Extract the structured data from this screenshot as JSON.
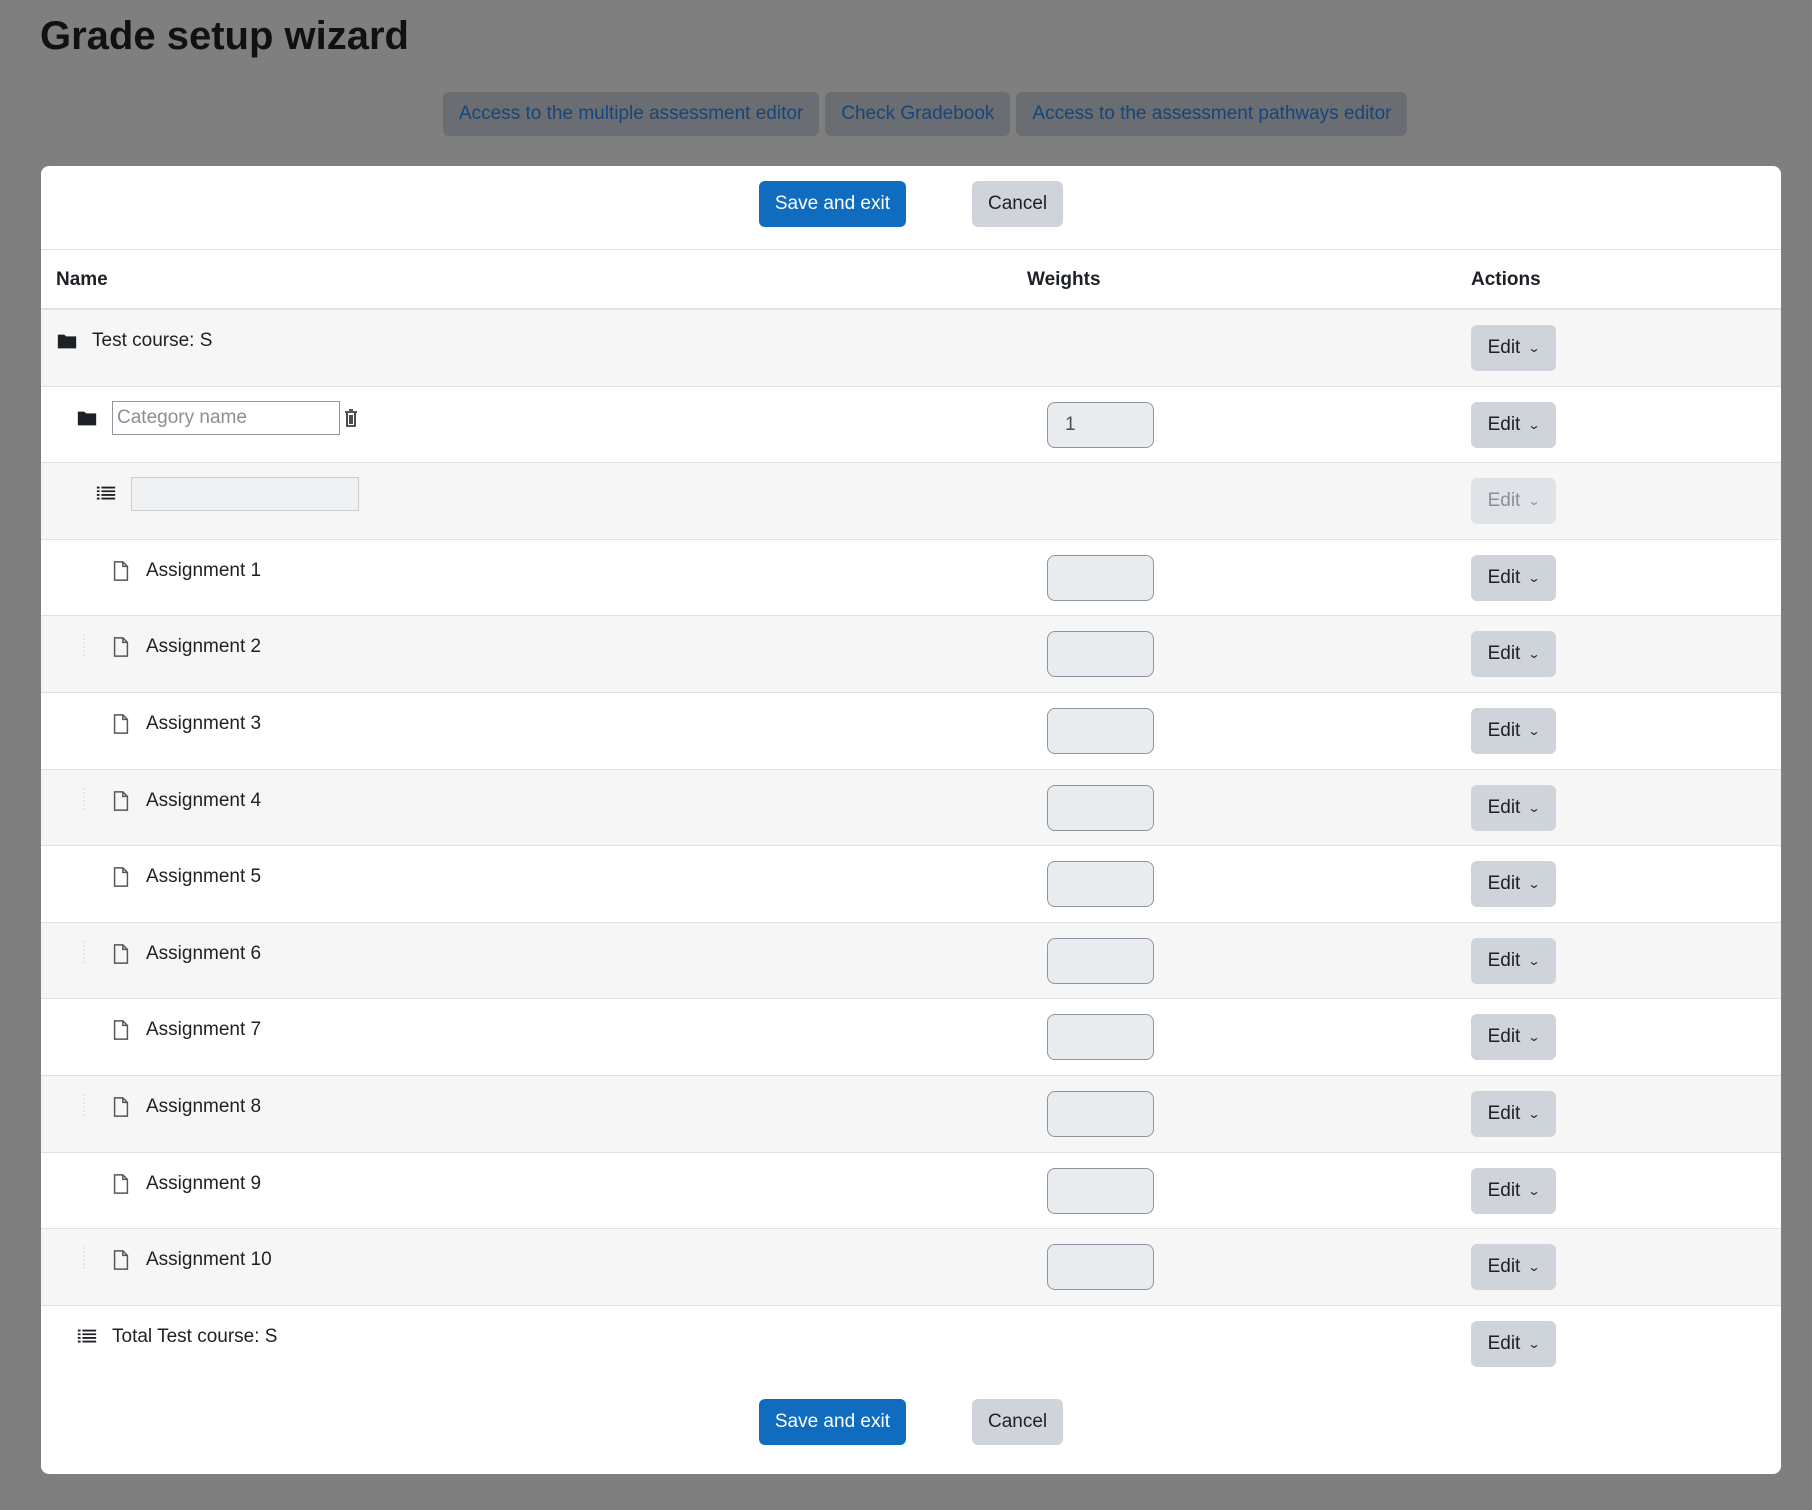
{
  "page": {
    "title": "Grade setup wizard",
    "top_links": [
      {
        "label": "Access to the multiple assessment editor"
      },
      {
        "label": "Check Gradebook"
      },
      {
        "label": "Access to the assessment pathways editor"
      }
    ]
  },
  "buttons": {
    "save": "Save and exit",
    "cancel": "Cancel"
  },
  "table": {
    "headers": {
      "name": "Name",
      "weights": "Weights",
      "actions": "Actions"
    },
    "course": {
      "name": "Test course: S",
      "edit": "Edit",
      "icon": "folder-icon"
    },
    "category": {
      "placeholder": "Category name",
      "value": "",
      "weight": "1",
      "edit": "Edit",
      "icon": "folder-icon",
      "delete_icon": "trash-icon"
    },
    "category_total": {
      "value": "",
      "edit": "Edit",
      "edit_disabled": true,
      "icon": "list-icon"
    },
    "items": [
      {
        "name": "Assignment 1",
        "weight": "",
        "edit": "Edit"
      },
      {
        "name": "Assignment 2",
        "weight": "",
        "edit": "Edit"
      },
      {
        "name": "Assignment 3",
        "weight": "",
        "edit": "Edit"
      },
      {
        "name": "Assignment 4",
        "weight": "",
        "edit": "Edit"
      },
      {
        "name": "Assignment 5",
        "weight": "",
        "edit": "Edit"
      },
      {
        "name": "Assignment 6",
        "weight": "",
        "edit": "Edit"
      },
      {
        "name": "Assignment 7",
        "weight": "",
        "edit": "Edit"
      },
      {
        "name": "Assignment 8",
        "weight": "",
        "edit": "Edit"
      },
      {
        "name": "Assignment 9",
        "weight": "",
        "edit": "Edit"
      },
      {
        "name": "Assignment 10",
        "weight": "",
        "edit": "Edit"
      }
    ],
    "course_total": {
      "name": "Total Test course: S",
      "edit": "Edit",
      "icon": "list-icon"
    }
  },
  "colors": {
    "primary": "#0f6cbf",
    "secondary": "#ced4da",
    "backdrop": "#7f7f7f"
  }
}
